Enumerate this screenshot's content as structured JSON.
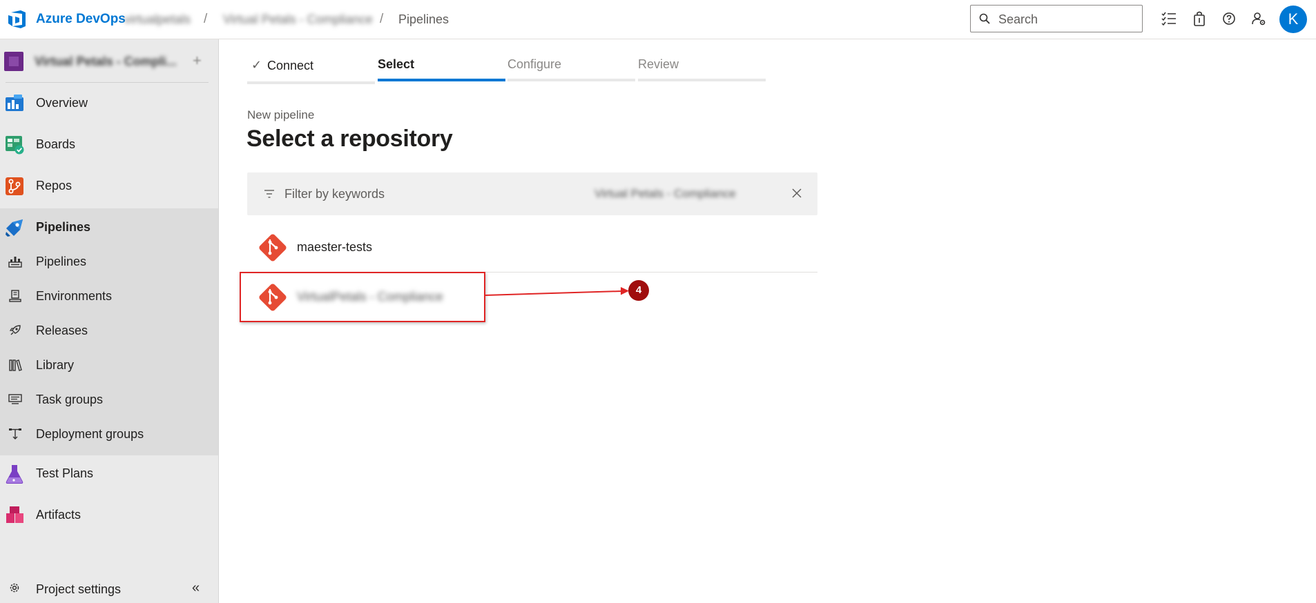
{
  "header": {
    "brand": "Azure DevOps",
    "org": "virtualpetals",
    "project": "Virtual Petals - Compliance",
    "page": "Pipelines",
    "search_placeholder": "Search",
    "avatar_initial": "K",
    "sep": "/"
  },
  "sidebar": {
    "project_name": "Virtual Petals - Compli...",
    "add_label": "+",
    "items": [
      {
        "label": "Overview",
        "icon": "overview-icon"
      },
      {
        "label": "Boards",
        "icon": "boards-icon"
      },
      {
        "label": "Repos",
        "icon": "repos-icon"
      },
      {
        "label": "Pipelines",
        "icon": "pipelines-icon",
        "active": true
      },
      {
        "label": "Test Plans",
        "icon": "test-plans-icon"
      },
      {
        "label": "Artifacts",
        "icon": "artifacts-icon"
      }
    ],
    "sub_items": [
      {
        "label": "Pipelines",
        "icon": "pipelines-sub-icon"
      },
      {
        "label": "Environments",
        "icon": "environments-icon"
      },
      {
        "label": "Releases",
        "icon": "releases-icon"
      },
      {
        "label": "Library",
        "icon": "library-icon"
      },
      {
        "label": "Task groups",
        "icon": "task-groups-icon"
      },
      {
        "label": "Deployment groups",
        "icon": "deployment-groups-icon"
      }
    ],
    "settings_label": "Project settings",
    "collapse_label": "«"
  },
  "wizard": {
    "steps": [
      {
        "label": "Connect",
        "state": "done"
      },
      {
        "label": "Select",
        "state": "active"
      },
      {
        "label": "Configure",
        "state": "pending"
      },
      {
        "label": "Review",
        "state": "pending"
      }
    ],
    "check_mark": "✓"
  },
  "main": {
    "subtitle": "New pipeline",
    "title": "Select a repository",
    "filter_placeholder": "Filter by keywords",
    "filter_selected": "Virtual Petals - Compliance",
    "repos": [
      {
        "name": "maester-tests"
      },
      {
        "name": "VirtualPetals - Compliance"
      }
    ],
    "annotation_number": "4"
  },
  "colors": {
    "accent": "#0078d4",
    "sidebar_bg": "#eaeaea",
    "sidebar_group_bg": "#dcdcdc",
    "git_orange": "#e64b34",
    "annotation_red": "#e02525",
    "badge_red": "#a00d0d"
  }
}
